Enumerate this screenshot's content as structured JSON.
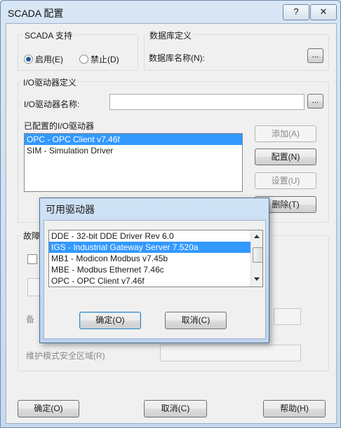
{
  "window": {
    "title": "SCADA 配置",
    "help_btn": "?",
    "close_btn": "✕"
  },
  "scada_support": {
    "group_label": "SCADA 支持",
    "enable_label": "启用(E)",
    "disable_label": "禁止(D)",
    "selected": "enable"
  },
  "database": {
    "group_label": "数据库定义",
    "name_label": "数据库名称(N):",
    "browse_btn": "..."
  },
  "io_driver": {
    "group_label": "I/O驱动器定义",
    "name_label": "I/O驱动器名称:",
    "name_value": "",
    "browse_btn": "...",
    "configured_label": "已配置的I/O驱动器",
    "configured_items": [
      "OPC - OPC Client v7.46f",
      "SIM - Simulation Driver"
    ],
    "selected_index": 0,
    "add_btn": "添加(A)",
    "config_btn": "配置(N)",
    "setup_btn": "设置(U)",
    "delete_btn": "删除(T)"
  },
  "failover": {
    "group_label": "故障",
    "backup_label": "备",
    "maintenance_label": "维护模式安全区域(R)"
  },
  "footer": {
    "ok_btn": "确定(O)",
    "cancel_btn": "取消(C)",
    "help_btn": "帮助(H)"
  },
  "dialog": {
    "title": "可用驱动器",
    "drivers": [
      "DDE - 32-bit DDE Driver Rev 6.0",
      "IGS - Industrial Gateway Server 7.520a",
      "MB1 - Modicon Modbus v7.45b",
      "MBE - Modbus Ethernet 7.46c",
      "OPC - OPC Client v7.46f"
    ],
    "selected_index": 1,
    "ok_btn": "确定(O)",
    "cancel_btn": "取消(C)"
  },
  "colors": {
    "selection": "#3399ff",
    "title_bg": "#cfe0f1"
  },
  "icons": {
    "radio": "radio-button",
    "scroll_up": "triangle-up",
    "scroll_down": "triangle-down"
  }
}
